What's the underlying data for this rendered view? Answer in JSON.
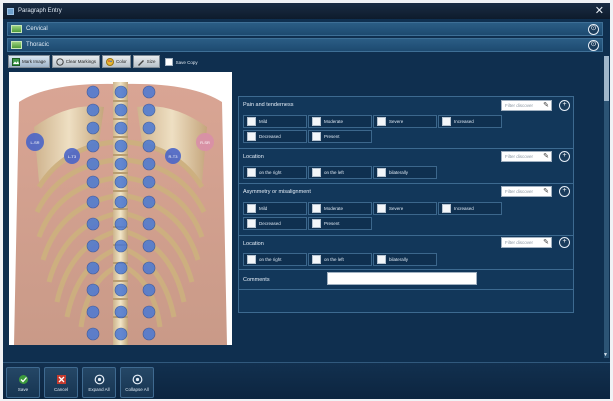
{
  "window": {
    "title": "Paragraph Entry"
  },
  "sections": [
    {
      "label": "Cervical"
    },
    {
      "label": "Thoracic"
    }
  ],
  "toolbar": {
    "mark_image": "Mark Image",
    "clear_markings": "Clear Markings",
    "color": "Color",
    "size": "Size",
    "save_copy": "Save Copy"
  },
  "filter_placeholder": "Filter discover",
  "groups": [
    {
      "label": "Pain and tenderness",
      "options": [
        "Mild",
        "Moderate",
        "Severe",
        "Increased",
        "Decreased",
        "Present"
      ]
    },
    {
      "label": "Location",
      "options": [
        "on the right",
        "on the left",
        "bilaterally"
      ]
    },
    {
      "label": "Asymmetry or misalignment",
      "options": [
        "Mild",
        "Moderate",
        "Severe",
        "Increased",
        "Decreased",
        "Present"
      ]
    },
    {
      "label": "Location",
      "options": [
        "on the right",
        "on the left",
        "bilaterally"
      ]
    }
  ],
  "comments_label": "Comments",
  "vertebra_labels": {
    "left_scapula": "L-SR",
    "right_scapula": "R-SR",
    "left_t3": "L-T3",
    "right_t3": "R-T3"
  },
  "bottom": {
    "save": "Save",
    "cancel": "Cancel",
    "expand_all": "Expand All",
    "collapse_all": "Collapse All"
  },
  "colors": {
    "accent": "#1d4a70",
    "panel": "#12375a",
    "marker": "#4a78d4"
  }
}
